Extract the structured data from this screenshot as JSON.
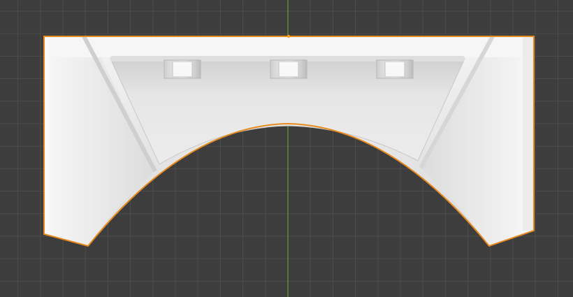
{
  "viewport": {
    "view": "front-orthographic",
    "background": "#3d3d3d",
    "grid_color": "#4d4d4d",
    "axis_color": "#6b9b2e",
    "selection_outline": "#e68a1f",
    "origin_dot": "#ff9c1a"
  },
  "object": {
    "shape": "arch-shelf-bracket",
    "selected": true,
    "base_color": "#e8e8e8",
    "shadow_color": "#c4c4c4",
    "peg_count": 3
  }
}
